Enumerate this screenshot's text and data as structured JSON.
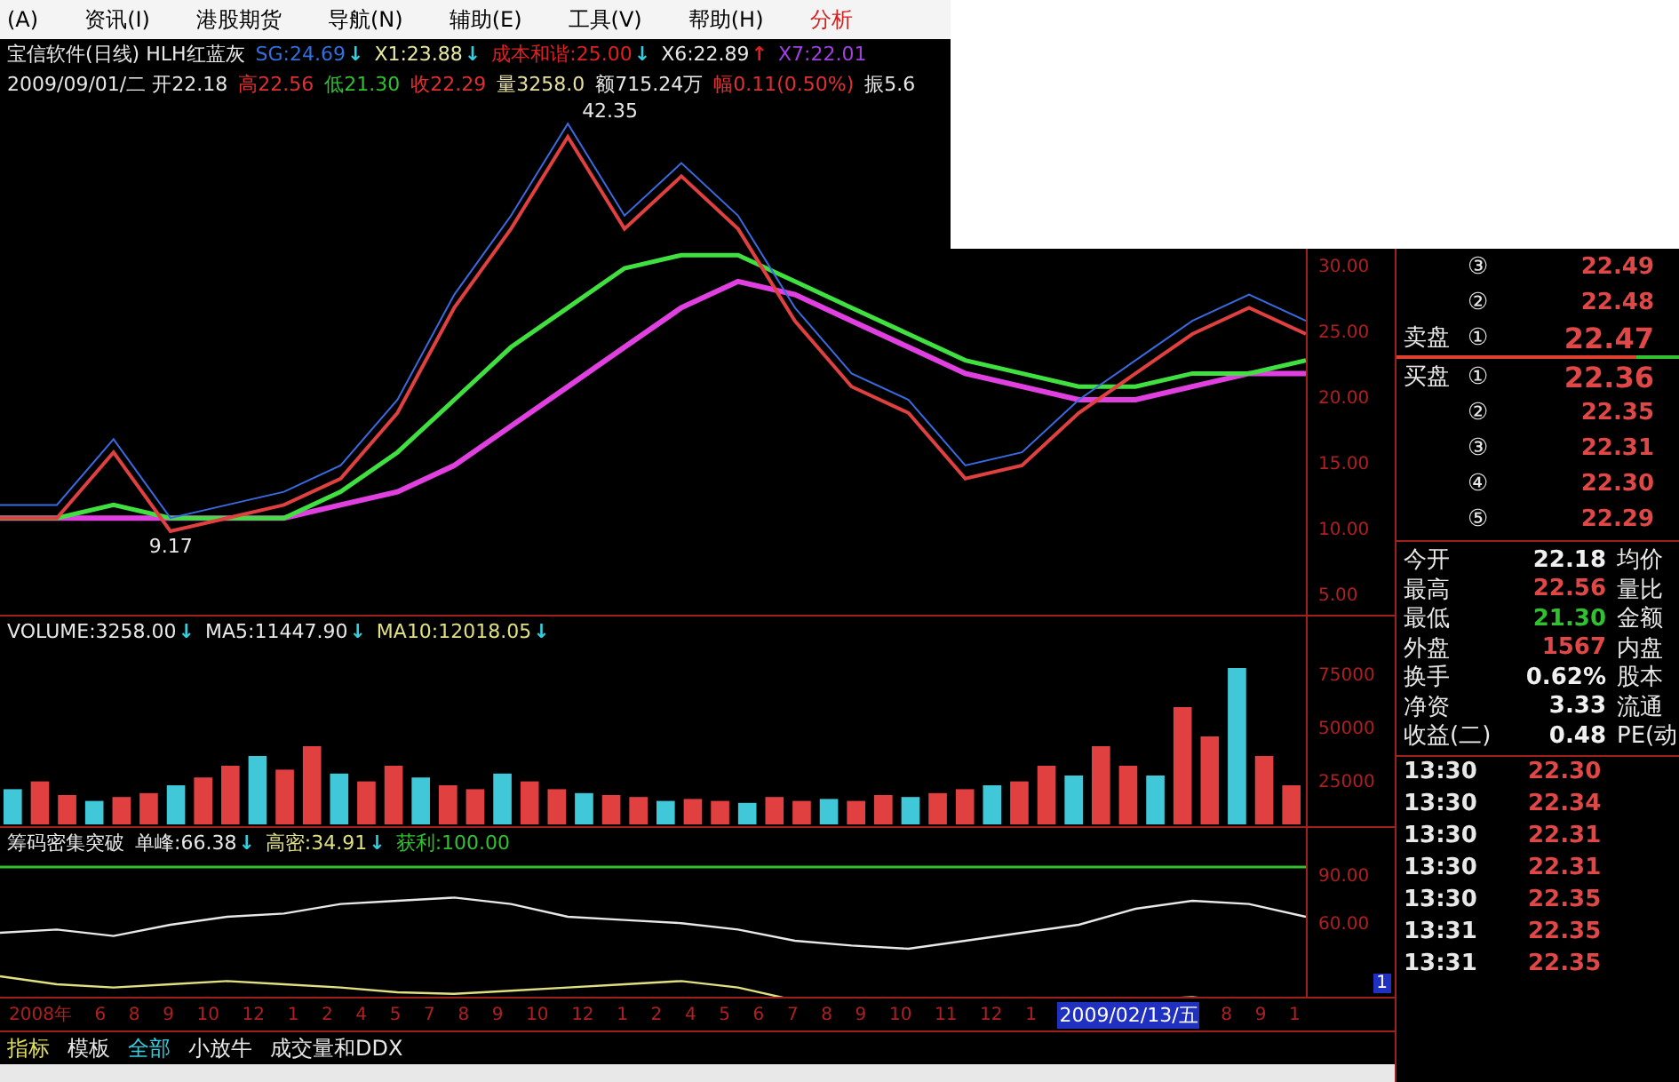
{
  "menu": [
    {
      "label": "(A)",
      "color": "#000000"
    },
    {
      "label": "资讯(I)",
      "color": "#000000"
    },
    {
      "label": "港股期货",
      "color": "#000000"
    },
    {
      "label": "导航(N)",
      "color": "#000000"
    },
    {
      "label": "辅助(E)",
      "color": "#000000"
    },
    {
      "label": "工具(V)",
      "color": "#000000"
    },
    {
      "label": "帮助(H)",
      "color": "#000000"
    },
    {
      "label": "分析",
      "color": "#d42020"
    }
  ],
  "indicator_legend": [
    {
      "text": "宝信软件(日线) HLH红蓝灰",
      "color": "#e8e8e8"
    },
    {
      "text": "SG:24.69",
      "color": "#3070e0"
    },
    {
      "kind": "arrow",
      "text": "↓",
      "color": "#30d0e0"
    },
    {
      "text": "X1:23.88",
      "color": "#e8e8a0"
    },
    {
      "kind": "arrow",
      "text": "↓",
      "color": "#30d0e0"
    },
    {
      "text": "成本和谐:25.00",
      "color": "#e02020"
    },
    {
      "kind": "arrow",
      "text": "↓",
      "color": "#30d0e0"
    },
    {
      "text": "X6:22.89",
      "color": "#e8e8e8"
    },
    {
      "kind": "arrow",
      "text": "↑",
      "color": "#e02020"
    },
    {
      "text": "X7:22.01",
      "color": "#a040e0"
    }
  ],
  "quote_line": [
    {
      "text": "2009/09/01/二 开22.18",
      "color": "#e8e8e8"
    },
    {
      "text": "高22.56",
      "color": "#e03030"
    },
    {
      "text": "低21.30",
      "color": "#30c030"
    },
    {
      "text": "收22.29",
      "color": "#e03030"
    },
    {
      "text": "量3258.0",
      "color": "#e8e0a0"
    },
    {
      "text": "额715.24万",
      "color": "#e8e8e8"
    },
    {
      "text": "幅0.11(0.50%)",
      "color": "#e03030"
    },
    {
      "text": "振5.6",
      "color": "#e8e8e8"
    }
  ],
  "price_axis": [
    "30.00",
    "25.00",
    "20.00",
    "15.00",
    "10.00",
    "5.00"
  ],
  "price_labels": [
    "42.35",
    "9.17"
  ],
  "volume_legend": [
    {
      "text": "VOLUME:3258.00",
      "color": "#e8e8e8"
    },
    {
      "kind": "arrow",
      "text": "↓",
      "color": "#30d0e0"
    },
    {
      "text": "MA5:11447.90",
      "color": "#e8e8e8"
    },
    {
      "kind": "arrow",
      "text": "↓",
      "color": "#30d0e0"
    },
    {
      "text": "MA10:12018.05",
      "color": "#e0e080"
    },
    {
      "kind": "arrow",
      "text": "↓",
      "color": "#30d0e0"
    }
  ],
  "volume_axis": [
    "75000",
    "50000",
    "25000"
  ],
  "chip_legend": [
    {
      "text": "筹码密集突破",
      "color": "#e8e8e8"
    },
    {
      "text": "单峰:66.38",
      "color": "#e8e8e8"
    },
    {
      "kind": "arrow",
      "text": "↓",
      "color": "#30d0e0"
    },
    {
      "text": "高密:34.91",
      "color": "#e0e080"
    },
    {
      "kind": "arrow",
      "text": "↓",
      "color": "#30d0e0"
    },
    {
      "text": "获利:100.00",
      "color": "#30c030"
    }
  ],
  "chip_axis": [
    "90.00",
    "60.00"
  ],
  "date_axis": [
    {
      "label": "2008年",
      "selected": false
    },
    {
      "label": "6",
      "selected": false
    },
    {
      "label": "8",
      "selected": false
    },
    {
      "label": "9",
      "selected": false
    },
    {
      "label": "10",
      "selected": false
    },
    {
      "label": "12",
      "selected": false
    },
    {
      "label": "1",
      "selected": false
    },
    {
      "label": "2",
      "selected": false
    },
    {
      "label": "4",
      "selected": false
    },
    {
      "label": "5",
      "selected": false
    },
    {
      "label": "7",
      "selected": false
    },
    {
      "label": "8",
      "selected": false
    },
    {
      "label": "9",
      "selected": false
    },
    {
      "label": "10",
      "selected": false
    },
    {
      "label": "12",
      "selected": false
    },
    {
      "label": "1",
      "selected": false
    },
    {
      "label": "2",
      "selected": false
    },
    {
      "label": "4",
      "selected": false
    },
    {
      "label": "5",
      "selected": false
    },
    {
      "label": "6",
      "selected": false
    },
    {
      "label": "7",
      "selected": false
    },
    {
      "label": "8",
      "selected": false
    },
    {
      "label": "9",
      "selected": false
    },
    {
      "label": "10",
      "selected": false
    },
    {
      "label": "11",
      "selected": false
    },
    {
      "label": "12",
      "selected": false
    },
    {
      "label": "1",
      "selected": false
    },
    {
      "label": "2009/02/13/五",
      "selected": true
    },
    {
      "label": "8",
      "selected": false
    },
    {
      "label": "9",
      "selected": false
    },
    {
      "label": "1",
      "selected": false
    }
  ],
  "scroll_badge": "1",
  "tab_group_label": "指标",
  "bottom_tabs": [
    {
      "label": "模板",
      "selected": false
    },
    {
      "label": "全部",
      "selected": true
    },
    {
      "label": "小放牛",
      "selected": false
    },
    {
      "label": "成交量和DDX",
      "selected": false
    }
  ],
  "order_book": {
    "asks": [
      {
        "level": "③",
        "price": "22.49"
      },
      {
        "level": "②",
        "price": "22.48"
      },
      {
        "side": "卖盘",
        "level": "①",
        "price": "22.47"
      }
    ],
    "bids": [
      {
        "side": "买盘",
        "level": "①",
        "price": "22.36"
      },
      {
        "level": "②",
        "price": "22.35"
      },
      {
        "level": "③",
        "price": "22.31"
      },
      {
        "level": "④",
        "price": "22.30"
      },
      {
        "level": "⑤",
        "price": "22.29"
      }
    ]
  },
  "stats": [
    {
      "label": "今开",
      "value": "22.18",
      "color": "#f0f0f0",
      "label2": "均价"
    },
    {
      "label": "最高",
      "value": "22.56",
      "color": "#e04848",
      "label2": "量比"
    },
    {
      "label": "最低",
      "value": "21.30",
      "color": "#30c030",
      "label2": "金额"
    },
    {
      "label": "外盘",
      "value": "1567",
      "color": "#e04848",
      "label2": "内盘"
    },
    {
      "label": "换手",
      "value": "0.62%",
      "color": "#f0f0f0",
      "label2": "股本"
    },
    {
      "label": "净资",
      "value": "3.33",
      "color": "#f0f0f0",
      "label2": "流通"
    },
    {
      "label": "收益(二)",
      "value": "0.48",
      "color": "#f0f0f0",
      "label2": "PE(动"
    }
  ],
  "ticks": [
    {
      "time": "13:30",
      "price": "22.30"
    },
    {
      "time": "13:30",
      "price": "22.34"
    },
    {
      "time": "13:30",
      "price": "22.31"
    },
    {
      "time": "13:30",
      "price": "22.31"
    },
    {
      "time": "13:30",
      "price": "22.35"
    },
    {
      "time": "13:31",
      "price": "22.35"
    },
    {
      "time": "13:31",
      "price": "22.35"
    }
  ]
}
